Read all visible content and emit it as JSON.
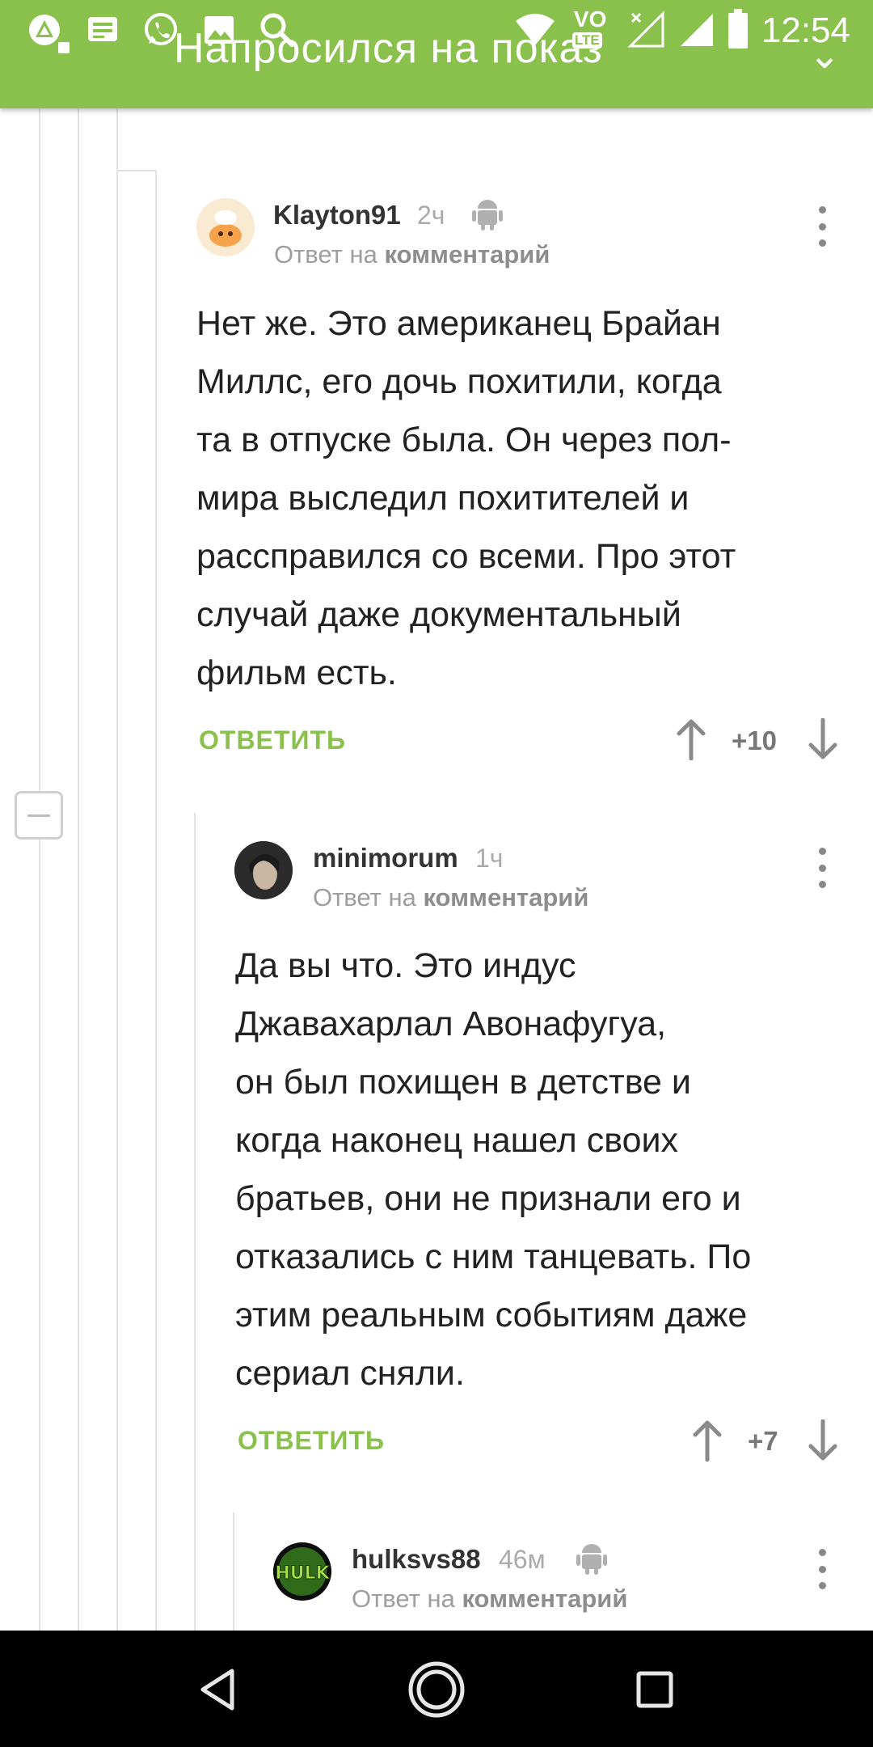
{
  "status_bar": {
    "time": "12:54",
    "volte_label": "VO",
    "lte_label": "LTE",
    "left_icons": [
      "app-notification-icon",
      "message-icon",
      "whatsapp-icon",
      "gallery-icon",
      "search-icon"
    ],
    "right_icons": [
      "wifi-icon",
      "volte-icon",
      "signal-no-icon",
      "signal-icon",
      "battery-icon"
    ]
  },
  "header": {
    "title": "Напросился на показ"
  },
  "comments": [
    {
      "username": "Klayton91",
      "time": "2ч",
      "platform_icon": "android-icon",
      "reply_to_prefix": "Ответ на",
      "reply_to_link": "комментарий",
      "body_lines": [
        "Нет же. Это американец Брайан",
        "Миллс, его дочь похитили, когда",
        "та в отпуске была. Он через пол-",
        "мира выследил похитителей и",
        "рассправился со всеми. Про этот",
        "случай даже документальный",
        "фильм есть."
      ],
      "reply_label": "ОТВЕТИТЬ",
      "score": "+10"
    },
    {
      "username": "minimorum",
      "time": "1ч",
      "reply_to_prefix": "Ответ на",
      "reply_to_link": "комментарий",
      "body_lines": [
        "Да вы что. Это индус",
        "Джавахарлал Авонафугуа,",
        "он был похищен в детстве и",
        "когда наконец нашел своих",
        "братьев, они не признали его и",
        "отказались с ним танцевать. По",
        "этим реальным событиям даже",
        "сериал сняли."
      ],
      "reply_label": "ОТВЕТИТЬ",
      "score": "+7"
    },
    {
      "username": "hulksvs88",
      "time": "46м",
      "platform_icon": "android-icon",
      "avatar_text": "HULK",
      "reply_to_prefix": "Ответ на",
      "reply_to_link": "комментарий"
    }
  ],
  "colors": {
    "accent": "#8ac14c",
    "text": "#222222",
    "muted": "#9e9e9e"
  },
  "navbar": {
    "icons": [
      "back-icon",
      "home-icon",
      "recents-icon"
    ]
  }
}
